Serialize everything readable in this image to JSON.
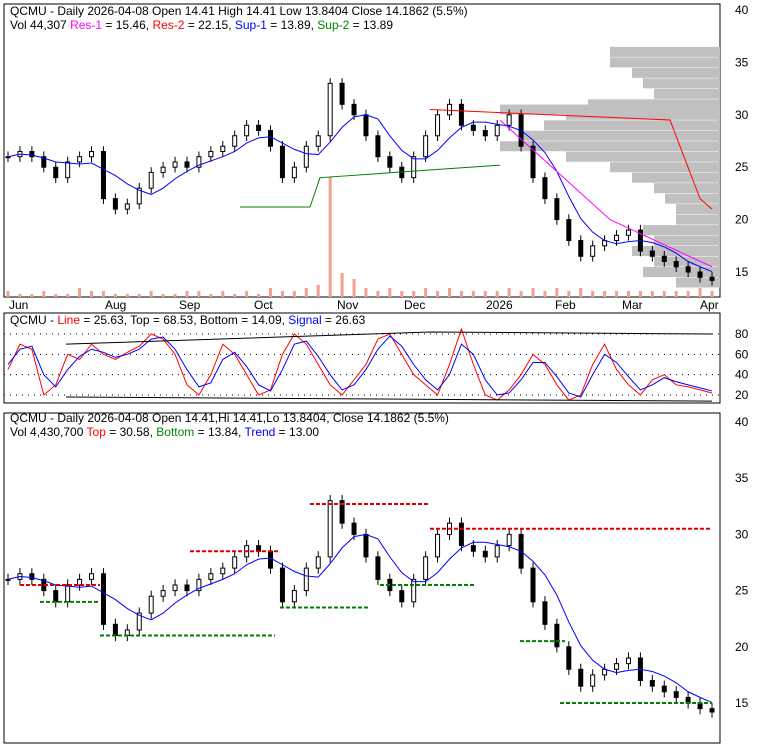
{
  "panel1": {
    "symbol": "QCMU",
    "title": "QCMU - Daily 2026-04-08 Open 14.41  High 14.41  Low 13.8404  Close 14.1862 (5.5%)",
    "vol": "Vol 44,307",
    "res1_label": "Res-1",
    "res1_val": " = 15.46,",
    "res2_label": "Res-2",
    "res2_val": " = 22.15,",
    "sup1_label": "Sup-1",
    "sup1_val": " = 13.89,",
    "sup2_label": "Sup-2",
    "sup2_val": " = 13.89"
  },
  "panel2": {
    "prefix": "QCMU - ",
    "line_label": "Line",
    "line_val": " = 25.63, Top = 68.53, Bottom = 14.09, ",
    "signal_label": "Signal",
    "signal_val": " = 26.63"
  },
  "panel3": {
    "title": "QCMU - Daily 2026-04-08 Open 14.41,Hi 14.41,Lo 13.8404, Close 14.1862 (5.5%)",
    "vol": "Vol 4,430,700 ",
    "top_label": "Top",
    "top_val": " = 30.58, ",
    "bottom_label": "Bottom",
    "bottom_val": " = 13.84, ",
    "trend_label": "Trend",
    "trend_val": " = 13.00"
  },
  "colors": {
    "up": "#ffffff",
    "down": "#000000",
    "res1": "#ff00ff",
    "res2": "#ff0000",
    "sup1": "#0000ff",
    "sup2": "#008000",
    "volume": "#f4a090",
    "profile": "#c0c0c0"
  },
  "chart_data": [
    {
      "type": "candlestick",
      "title": "QCMU - Daily",
      "ylim": [
        12,
        40
      ],
      "yticks": [
        15,
        20,
        25,
        30,
        35,
        40
      ],
      "xticks": [
        "Jun",
        "Aug",
        "Sep",
        "Oct",
        "Nov",
        "Dec",
        "2026",
        "Feb",
        "Mar",
        "Apr"
      ],
      "closes": [
        26,
        26.5,
        26,
        25,
        24,
        25.5,
        26,
        26.5,
        22,
        21,
        21.5,
        23,
        24.5,
        25,
        25.5,
        25,
        26,
        26.5,
        27,
        28,
        29,
        28.5,
        27,
        24,
        25,
        27,
        28,
        33,
        31,
        30,
        28,
        26,
        25,
        24,
        26,
        28,
        30,
        31,
        29,
        28.5,
        28,
        29,
        30,
        27,
        24,
        22,
        20,
        18,
        16.5,
        17.5,
        18,
        18.5,
        19,
        17,
        16.5,
        16,
        15.5,
        15,
        14.5,
        14.2
      ],
      "volume": [
        2,
        1,
        1,
        2,
        1,
        1,
        3,
        2,
        2,
        1,
        1,
        1,
        2,
        1,
        1,
        2,
        2,
        1,
        2,
        1,
        2,
        1,
        3,
        2,
        2,
        3,
        4,
        40,
        8,
        6,
        3,
        2,
        3,
        2,
        2,
        3,
        2,
        3,
        2,
        2,
        2,
        2,
        3,
        2,
        3,
        2,
        3,
        2,
        3,
        2,
        2,
        2,
        2,
        2,
        2,
        2,
        2,
        2,
        3,
        2
      ],
      "profile": [
        [
          36,
          0.5
        ],
        [
          35,
          0.5
        ],
        [
          34,
          0.4
        ],
        [
          33,
          0.35
        ],
        [
          32,
          0.3
        ],
        [
          31,
          0.6
        ],
        [
          30.5,
          1
        ],
        [
          30,
          0.7
        ],
        [
          29,
          0.8
        ],
        [
          28,
          0.9
        ],
        [
          27,
          1
        ],
        [
          26,
          0.7
        ],
        [
          25,
          0.5
        ],
        [
          24,
          0.4
        ],
        [
          23,
          0.3
        ],
        [
          22,
          0.25
        ],
        [
          21,
          0.2
        ],
        [
          20,
          0.2
        ],
        [
          19,
          0.35
        ],
        [
          18,
          0.3
        ],
        [
          17,
          0.4
        ],
        [
          16,
          0.3
        ],
        [
          15,
          0.35
        ],
        [
          14,
          0.2
        ]
      ]
    },
    {
      "type": "line",
      "title": "Stochastic",
      "ylim": [
        10,
        90
      ],
      "yticks": [
        20,
        40,
        60,
        80
      ],
      "series": [
        {
          "name": "Line",
          "values": [
            45,
            70,
            65,
            20,
            30,
            60,
            55,
            70,
            60,
            55,
            62,
            68,
            80,
            75,
            60,
            30,
            20,
            40,
            70,
            60,
            40,
            20,
            25,
            60,
            80,
            70,
            50,
            30,
            20,
            35,
            50,
            75,
            80,
            60,
            40,
            30,
            20,
            50,
            85,
            50,
            20,
            15,
            25,
            40,
            60,
            50,
            30,
            15,
            20,
            50,
            70,
            45,
            30,
            20,
            35,
            40,
            30,
            28,
            25,
            22
          ]
        },
        {
          "name": "Signal",
          "values": [
            50,
            65,
            68,
            40,
            28,
            45,
            58,
            65,
            62,
            57,
            60,
            65,
            75,
            77,
            65,
            45,
            28,
            32,
            55,
            62,
            48,
            30,
            24,
            45,
            70,
            73,
            58,
            40,
            25,
            30,
            45,
            65,
            78,
            68,
            50,
            35,
            25,
            40,
            70,
            60,
            35,
            20,
            22,
            35,
            52,
            52,
            38,
            22,
            18,
            40,
            60,
            52,
            38,
            25,
            30,
            37,
            33,
            30,
            27,
            24
          ]
        }
      ]
    },
    {
      "type": "candlestick",
      "title": "QCMU - Daily (trend)",
      "ylim": [
        12,
        40
      ],
      "yticks": [
        15,
        20,
        25,
        30,
        35,
        40
      ]
    }
  ]
}
